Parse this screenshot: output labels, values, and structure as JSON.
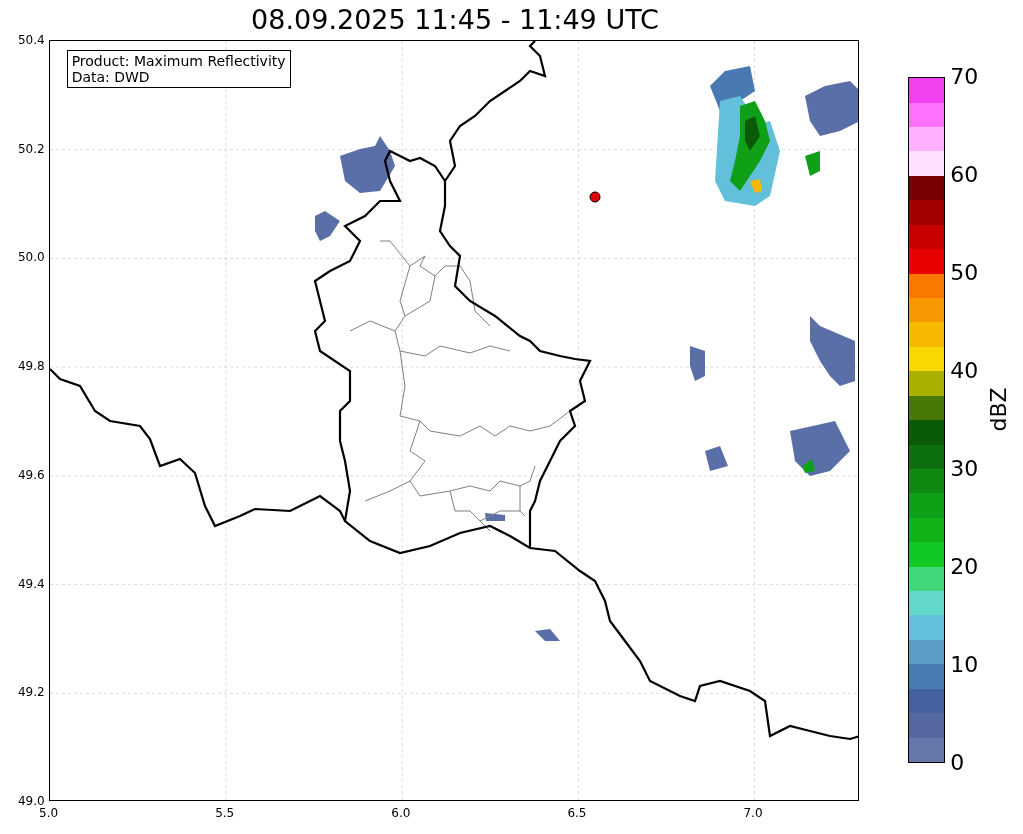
{
  "title": "08.09.2025 11:45 - 11:49 UTC",
  "info_box": {
    "lines": [
      "Product: Maximum Reflectivity",
      "Data: DWD"
    ]
  },
  "axes": {
    "yticks": [
      "50.4",
      "50.2",
      "50.0",
      "49.8",
      "49.6",
      "49.4",
      "49.2",
      "49.0"
    ],
    "xticks": [
      "5.0",
      "5.5",
      "6.0",
      "6.5",
      "7.0"
    ]
  },
  "colorbar": {
    "label": "dBZ",
    "ticks": [
      "70",
      "60",
      "50",
      "40",
      "30",
      "20",
      "10",
      "0"
    ],
    "segments": [
      {
        "color": "#6677aa"
      },
      {
        "color": "#5566a0"
      },
      {
        "color": "#4462a2"
      },
      {
        "color": "#4a7ab2"
      },
      {
        "color": "#5a9ec8"
      },
      {
        "color": "#62c0da"
      },
      {
        "color": "#62d8c8"
      },
      {
        "color": "#40d878"
      },
      {
        "color": "#12c822"
      },
      {
        "color": "#10b418"
      },
      {
        "color": "#10a018"
      },
      {
        "color": "#0e8a10"
      },
      {
        "color": "#0c7010"
      },
      {
        "color": "#0a5a0a"
      },
      {
        "color": "#4a7808"
      },
      {
        "color": "#aab000"
      },
      {
        "color": "#f8d800"
      },
      {
        "color": "#f8b800"
      },
      {
        "color": "#f89800"
      },
      {
        "color": "#f87800"
      },
      {
        "color": "#e80000"
      },
      {
        "color": "#c80000"
      },
      {
        "color": "#a00000"
      },
      {
        "color": "#780000"
      },
      {
        "color": "#ffe0ff"
      },
      {
        "color": "#ffb0ff"
      },
      {
        "color": "#ff70ff"
      },
      {
        "color": "#f040f0"
      }
    ]
  }
}
